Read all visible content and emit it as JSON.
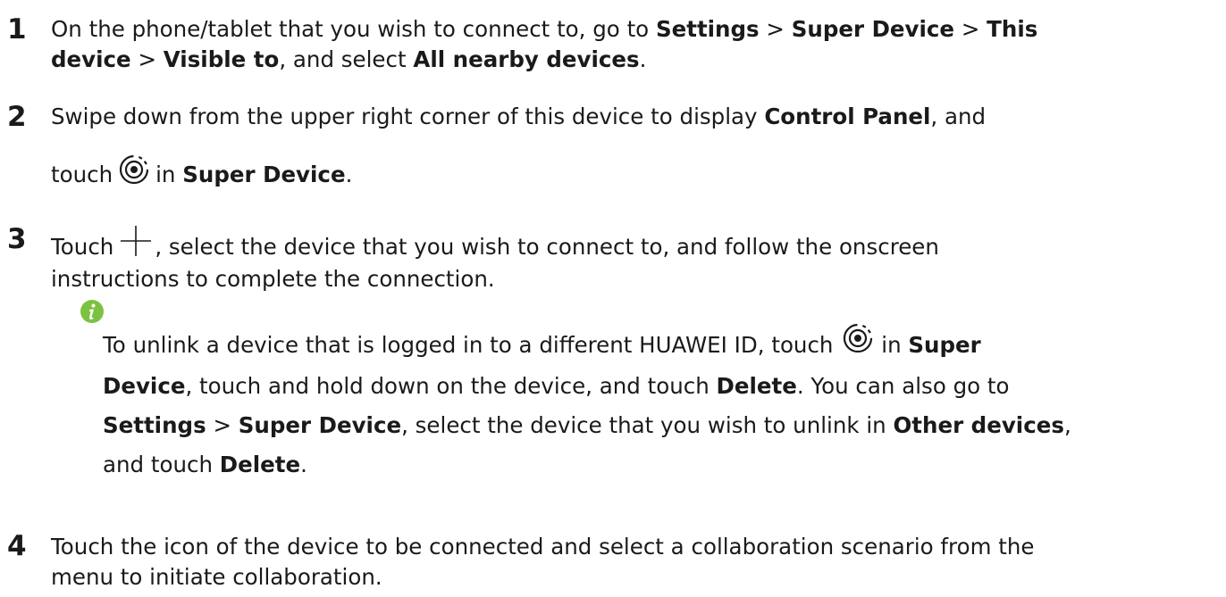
{
  "steps": [
    {
      "number": "1",
      "line1_a": "On the phone/tablet that you wish to connect to, go to ",
      "settings": "Settings",
      "sep1": " > ",
      "super_device": "Super Device",
      "sep2": " > ",
      "this": "This",
      "device": "device",
      "sep3": " > ",
      "visible_to": "Visible to",
      "mid": ", and select ",
      "all_nearby": "All nearby devices",
      "end": "."
    },
    {
      "number": "2",
      "line1": "Swipe down from the upper right corner of this device to display ",
      "control_panel": "Control Panel",
      "line1_end": ", and",
      "touch": "touch",
      "in": "in ",
      "super_device": "Super Device",
      "end": "."
    },
    {
      "number": "3",
      "touch": "Touch",
      "rest": ", select the device that you wish to connect to, and follow the onscreen",
      "line2": "instructions to complete the connection."
    },
    {
      "number": "4",
      "line1": "Touch the icon of the device to be connected and select a collaboration scenario from the",
      "line2": "menu to initiate collaboration."
    }
  ],
  "note": {
    "a": "To unlink a device that is logged in to a different HUAWEI ID, touch",
    "in": " in ",
    "super": "Super",
    "device": "Device",
    "b": ", touch and hold down on the device, and touch ",
    "delete1": "Delete",
    "c": ". You can also go to",
    "settings": "Settings",
    "sep": " > ",
    "super_device": "Super Device",
    "d": ", select the device that you wish to unlink in ",
    "other_devices": "Other devices",
    "e": ",",
    "f": "and touch ",
    "delete2": "Delete",
    "g": "."
  },
  "colors": {
    "note_icon": "#7cc242",
    "text": "#1a1a1a"
  },
  "icons": {
    "super_device": "super-device-icon",
    "plus": "plus-icon",
    "info": "info-icon"
  }
}
